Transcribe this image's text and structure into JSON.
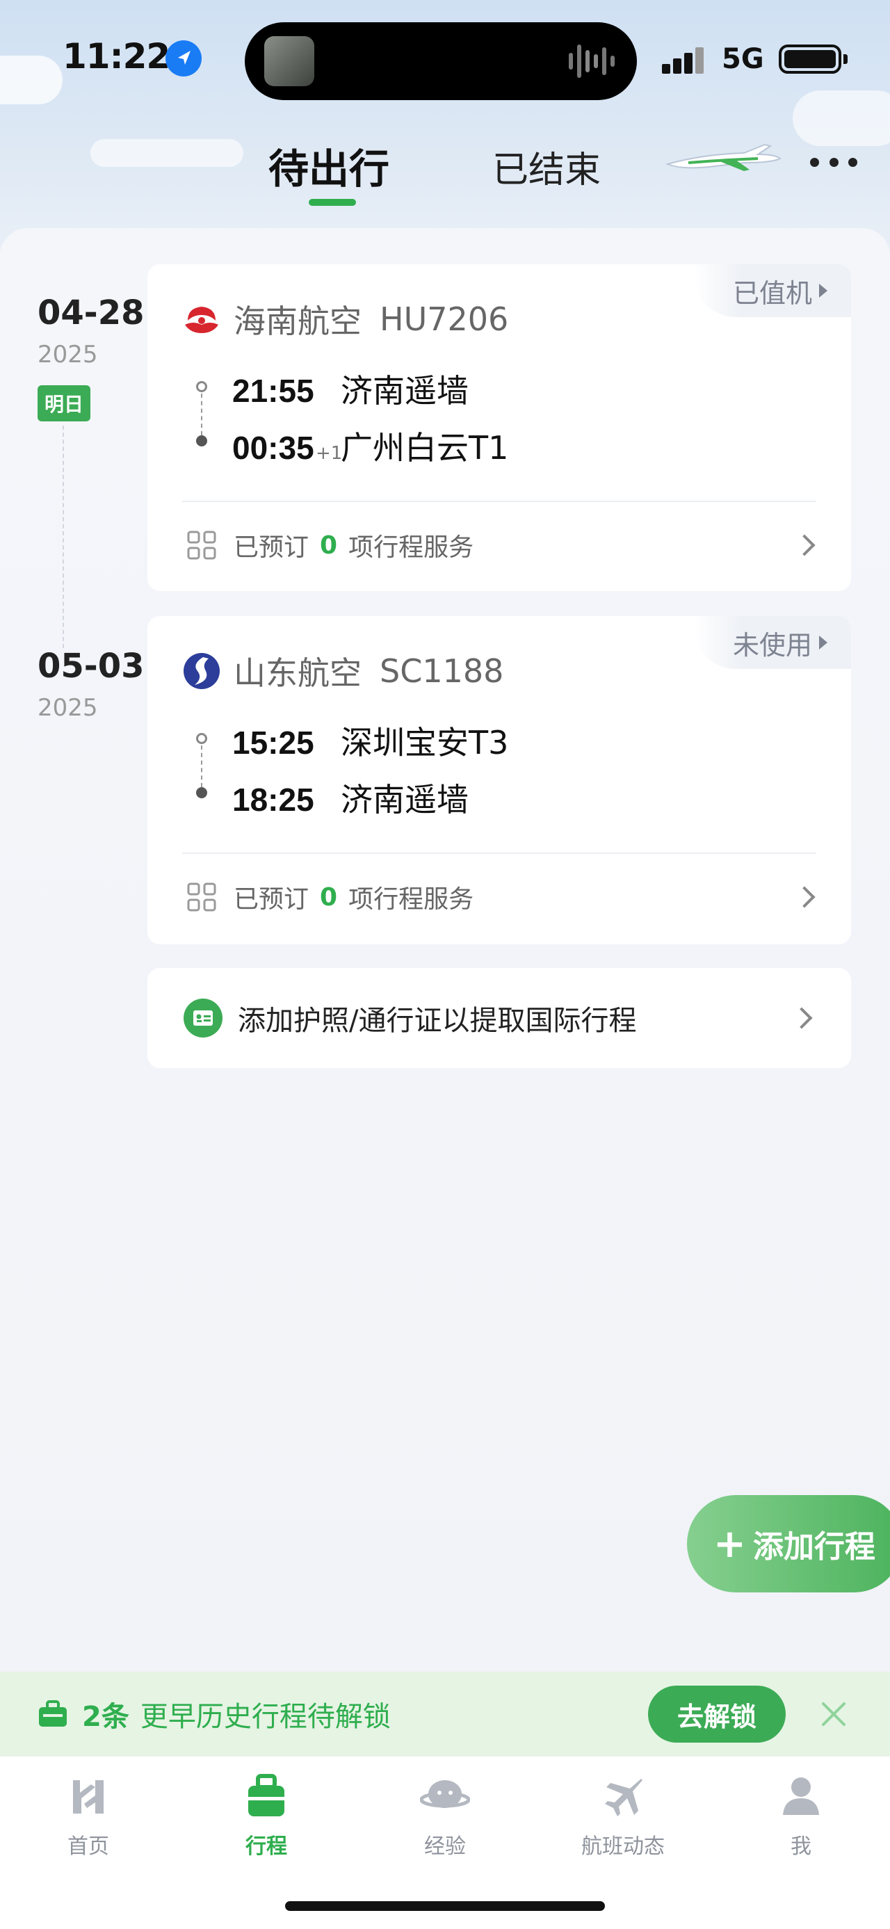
{
  "status_bar": {
    "time": "11:22",
    "network": "5G"
  },
  "tabs": {
    "upcoming": "待出行",
    "ended": "已结束"
  },
  "trips": [
    {
      "date": "04-28",
      "year": "2025",
      "badge": "明日",
      "status": "已值机",
      "airline": "海南航空",
      "flight_no": "HU7206",
      "dep_time": "21:55",
      "dep_airport": "济南遥墙",
      "arr_time": "00:35",
      "arr_plus": "+1",
      "arr_airport": "广州白云T1",
      "svc_prefix": "已预订",
      "svc_count": "0",
      "svc_suffix": "项行程服务"
    },
    {
      "date": "05-03",
      "year": "2025",
      "status": "未使用",
      "airline": "山东航空",
      "flight_no": "SC1188",
      "dep_time": "15:25",
      "dep_airport": "深圳宝安T3",
      "arr_time": "18:25",
      "arr_airport": "济南遥墙",
      "svc_prefix": "已预订",
      "svc_count": "0",
      "svc_suffix": "项行程服务"
    }
  ],
  "passport_prompt": "添加护照/通行证以提取国际行程",
  "add_trip_button": "添加行程",
  "unlock_banner": {
    "count": "2条",
    "text": "更早历史行程待解锁",
    "button": "去解锁"
  },
  "bottom_nav": [
    {
      "label": "首页",
      "icon": "home-icon"
    },
    {
      "label": "行程",
      "icon": "luggage-icon",
      "active": true
    },
    {
      "label": "经验",
      "icon": "chat-bubble-icon"
    },
    {
      "label": "航班动态",
      "icon": "airplane-icon"
    },
    {
      "label": "我",
      "icon": "user-icon"
    }
  ],
  "colors": {
    "accent": "#2fae4e",
    "status_text": "#7d8390",
    "background": "#f2f4f9"
  }
}
